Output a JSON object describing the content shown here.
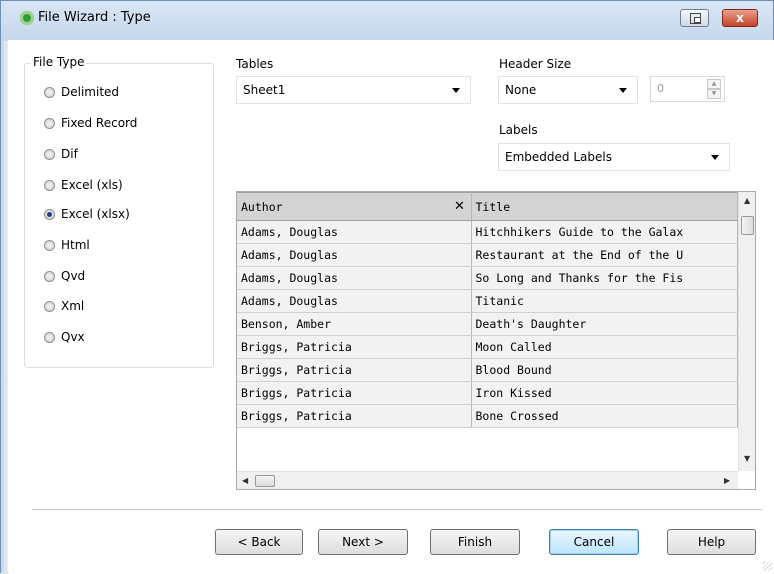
{
  "window": {
    "title": "File Wizard : Type",
    "close_label": "x"
  },
  "file_type": {
    "legend": "File Type",
    "options": [
      {
        "label": "Delimited",
        "checked": false
      },
      {
        "label": "Fixed Record",
        "checked": false
      },
      {
        "label": "Dif",
        "checked": false
      },
      {
        "label": "Excel (xls)",
        "checked": false
      },
      {
        "label": "Excel (xlsx)",
        "checked": true
      },
      {
        "label": "Html",
        "checked": false
      },
      {
        "label": "Qvd",
        "checked": false
      },
      {
        "label": "Xml",
        "checked": false
      },
      {
        "label": "Qvx",
        "checked": false
      }
    ]
  },
  "tables": {
    "label": "Tables",
    "value": "Sheet1"
  },
  "header_size": {
    "label": "Header Size",
    "value": "None",
    "spin_value": "0"
  },
  "labels": {
    "label": "Labels",
    "value": "Embedded Labels"
  },
  "grid": {
    "columns": [
      "Author",
      "Title"
    ],
    "rows": [
      [
        "Adams, Douglas",
        "Hitchhikers Guide to the Galax"
      ],
      [
        "Adams, Douglas",
        "Restaurant at the End of the U"
      ],
      [
        "Adams, Douglas",
        "So Long and Thanks for the Fis"
      ],
      [
        "Adams, Douglas",
        "Titanic"
      ],
      [
        "Benson, Amber",
        "Death's Daughter"
      ],
      [
        "Briggs, Patricia",
        "Moon Called"
      ],
      [
        "Briggs, Patricia",
        "Blood Bound"
      ],
      [
        "Briggs, Patricia",
        "Iron Kissed"
      ],
      [
        "Briggs, Patricia",
        "Bone Crossed"
      ]
    ]
  },
  "buttons": {
    "back": "< Back",
    "next": "Next >",
    "finish": "Finish",
    "cancel": "Cancel",
    "help": "Help"
  }
}
